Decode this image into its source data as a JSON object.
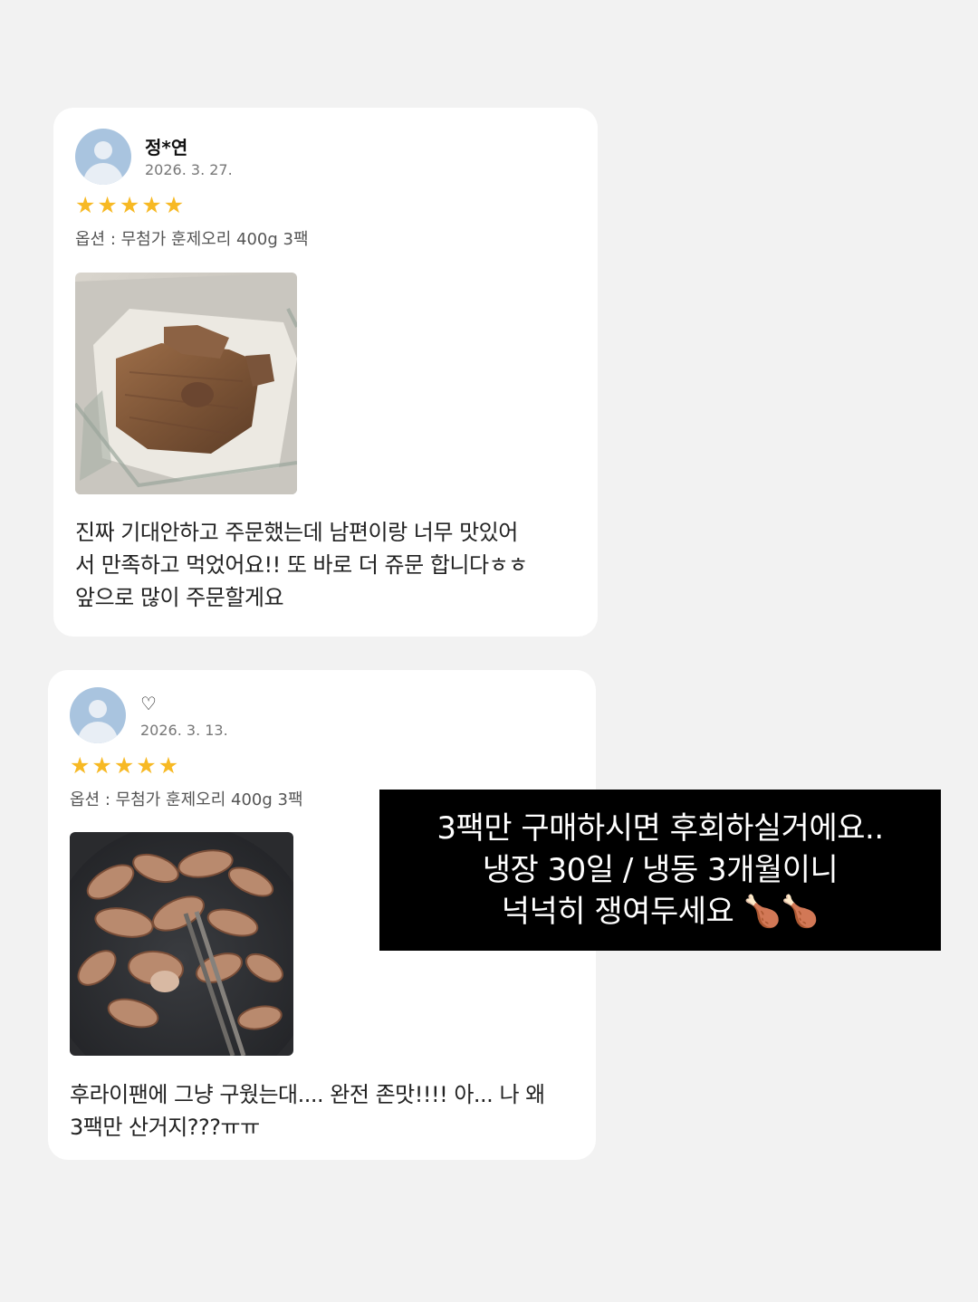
{
  "reviews": [
    {
      "author": "정*연",
      "date": "2026. 3. 27.",
      "rating": 5,
      "stars": [
        "★",
        "★",
        "★",
        "★",
        "★"
      ],
      "option": "옵션 : 무첨가 훈제오리 400g 3팩",
      "text": "진짜 기대안하고 주문했는데 남편이랑 너무 맛있어\n서 만족하고 먹었어요!! 또 바로 더 쥬문 합니다ㅎㅎ\n앞으로 많이 주문할게요"
    },
    {
      "author": "♡",
      "date": "2026. 3. 13.",
      "rating": 5,
      "stars": [
        "★",
        "★",
        "★",
        "★",
        "★"
      ],
      "option": "옵션 : 무첨가 훈제오리 400g 3팩",
      "text": "후라이팬에 그냥 구웠는대.... 완전 존맛!!!! 아... 나 왜\n3팩만 산거지???ㅠㅠ"
    }
  ],
  "overlay": {
    "lines": [
      "3팩만 구매하시면 후회하실거에요..",
      "냉장 30일 / 냉동 3개월이니",
      "넉넉히 쟁여두세요 🍗🍗"
    ]
  },
  "colors": {
    "background": "#f2f2f2",
    "card": "#ffffff",
    "star": "#f7b924",
    "avatar": "#a9c4df",
    "overlay_bg": "#000000",
    "overlay_text": "#ffffff"
  },
  "icons": {
    "avatar": "default-user-avatar-icon",
    "star": "star-icon"
  }
}
